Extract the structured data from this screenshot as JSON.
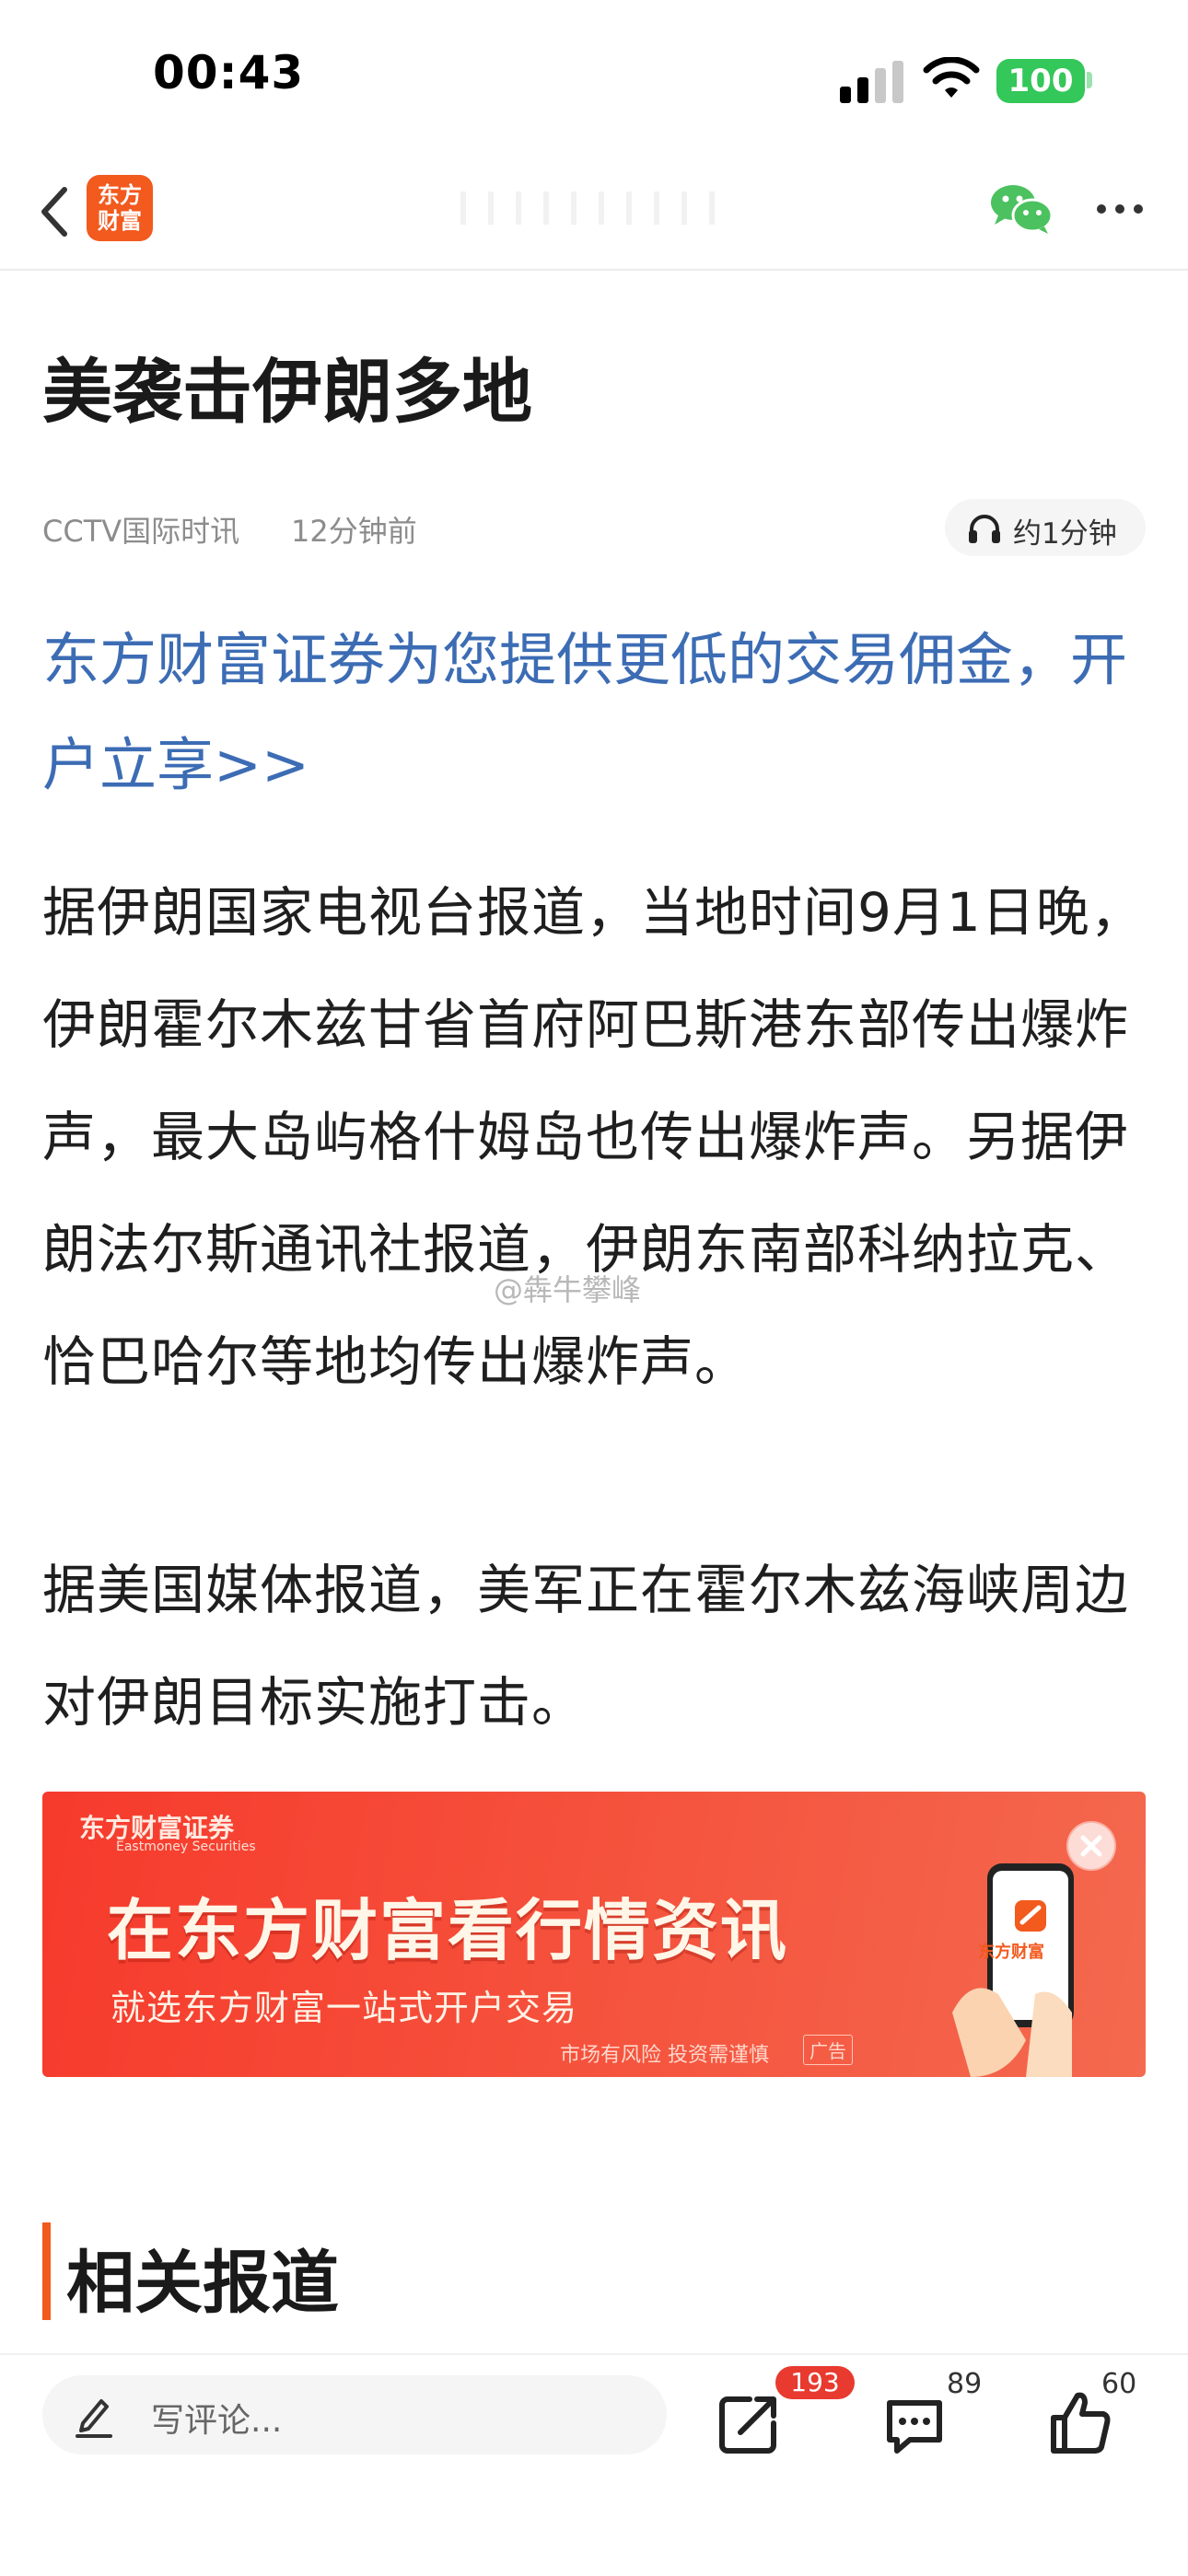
{
  "status_bar": {
    "time": "00:43",
    "battery": "100"
  },
  "nav": {
    "app_logo_line1": "东方",
    "app_logo_line2": "财富",
    "back_icon": "chevron-left-icon",
    "share_wechat_icon": "wechat-icon",
    "more_icon": "ellipsis-icon"
  },
  "article": {
    "title": "美袭击伊朗多地",
    "source": "CCTV国际时讯",
    "time_ago": "12分钟前",
    "listen_label": "约1分钟",
    "promo_link": "东方财富证券为您提供更低的交易佣金，开户立享>>",
    "paragraphs": [
      "据伊朗国家电视台报道，当地时间9月1日晚，伊朗霍尔木兹甘省首府阿巴斯港东部传出爆炸声，最大岛屿格什姆岛也传出爆炸声。另据伊朗法尔斯通讯社报道，伊朗东南部科纳拉克、恰巴哈尔等地均传出爆炸声。",
      "据美国媒体报道，美军正在霍尔木兹海峡周边对伊朗目标实施打击。"
    ],
    "watermark": "@犇牛攀峰"
  },
  "ad": {
    "brand": "东方财富证券",
    "brand_en": "Eastmoney Securities",
    "headline": "在东方财富看行情资讯",
    "subline": "就选东方财富一站式开户交易",
    "risk_notice": "市场有风险 投资需谨慎",
    "tag": "广告",
    "phone_brand": "东方财富"
  },
  "related": {
    "title": "相关报道"
  },
  "bottom_bar": {
    "comment_placeholder": "写评论...",
    "share_count": "193",
    "comment_count": "89",
    "like_count": "60"
  },
  "colors": {
    "brand_orange": "#f25a1e",
    "link_blue": "#3c6cb4",
    "badge_red": "#e83a2f",
    "battery_green": "#34c759"
  }
}
